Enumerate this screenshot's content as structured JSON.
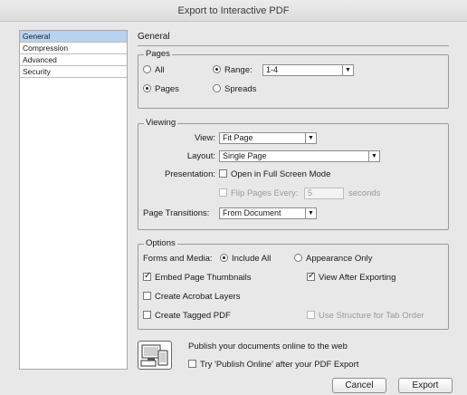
{
  "window": {
    "title": "Export to Interactive PDF"
  },
  "sidebar": {
    "items": [
      {
        "label": "General",
        "selected": true
      },
      {
        "label": "Compression"
      },
      {
        "label": "Advanced"
      },
      {
        "label": "Security"
      }
    ]
  },
  "main": {
    "title": "General"
  },
  "pages": {
    "legend": "Pages",
    "all_label": "All",
    "range_label": "Range:",
    "range_value": "1-4",
    "pages_label": "Pages",
    "spreads_label": "Spreads"
  },
  "viewing": {
    "legend": "Viewing",
    "view_label": "View:",
    "view_value": "Fit Page",
    "layout_label": "Layout:",
    "layout_value": "Single Page",
    "presentation_label": "Presentation:",
    "fullscreen_label": "Open in Full Screen Mode",
    "flip_label": "Flip Pages Every:",
    "flip_value": "5",
    "seconds_label": "seconds",
    "transitions_label": "Page Transitions:",
    "transitions_value": "From Document"
  },
  "options": {
    "legend": "Options",
    "forms_label": "Forms and Media:",
    "include_all_label": "Include All",
    "appearance_only_label": "Appearance Only",
    "embed_thumbs_label": "Embed Page Thumbnails",
    "view_after_label": "View After Exporting",
    "acrobat_layers_label": "Create Acrobat Layers",
    "tagged_pdf_label": "Create Tagged PDF",
    "structure_tab_label": "Use Structure for Tab Order"
  },
  "publish": {
    "heading": "Publish your documents online to the web",
    "checkbox_label": "Try 'Publish Online' after your PDF Export"
  },
  "buttons": {
    "cancel": "Cancel",
    "export": "Export"
  }
}
